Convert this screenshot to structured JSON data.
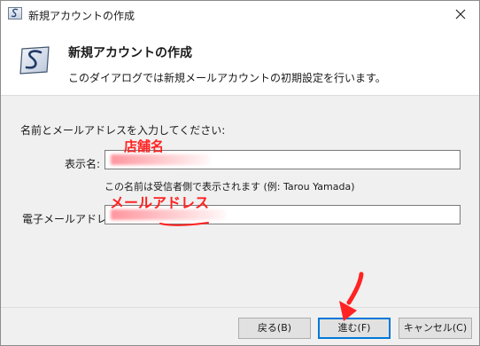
{
  "window": {
    "title": "新規アカウントの作成"
  },
  "header": {
    "title": "新規アカウントの作成",
    "description": "このダイアログでは新規メールアカウントの初期設定を行います。"
  },
  "form": {
    "section_label": "名前とメールアドレスを入力してください:",
    "display_name_label": "表示名:",
    "display_name_annotation": "店舗名",
    "hint": "この名前は受信者側で表示されます (例: Tarou Yamada)",
    "email_label": "電子メールアドレス:",
    "email_annotation": "メールアドレス"
  },
  "buttons": {
    "back": "戻る(B)",
    "next": "進む(F)",
    "cancel": "キャンセル(C)"
  },
  "colors": {
    "annotation": "#ff2323",
    "default_button_border": "#0078d7"
  }
}
